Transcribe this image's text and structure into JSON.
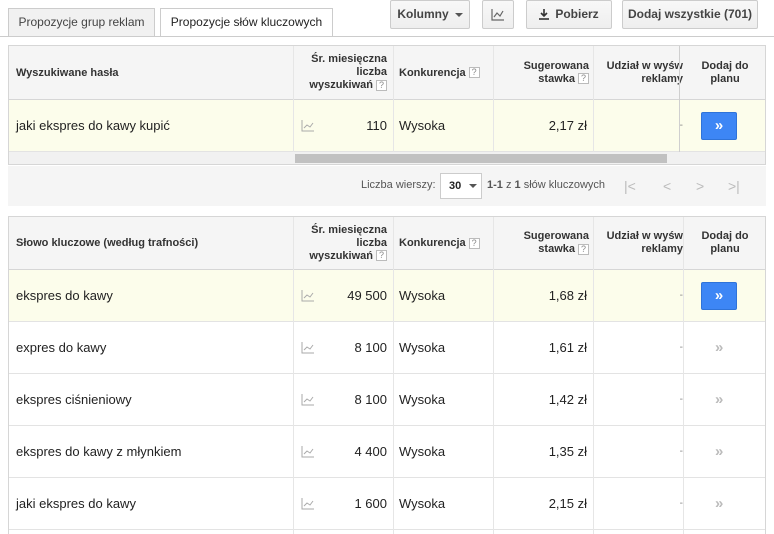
{
  "tabs": [
    {
      "label": "Propozycje grup reklam"
    },
    {
      "label": "Propozycje słów kluczowych"
    }
  ],
  "toolbar": {
    "columns_label": "Kolumny",
    "download_label": "Pobierz",
    "add_all_label": "Dodaj wszystkie (701)"
  },
  "searched": {
    "headers": {
      "term": "Wyszukiwane hasła",
      "avg1": "Śr. miesięczna",
      "avg2": "liczba",
      "avg3": "wyszukiwań",
      "competition": "Konkurencja",
      "bid1": "Sugerowana",
      "bid2": "stawka",
      "share1": "Udział w wyśw",
      "share2": "reklamy",
      "add1": "Dodaj do",
      "add2": "planu"
    },
    "rows": [
      {
        "term": "jaki ekspres do kawy kupić",
        "searches": "110",
        "competition": "Wysoka",
        "bid": "2,17 zł",
        "share": "-",
        "add": "»"
      }
    ]
  },
  "pager": {
    "rows_label": "Liczba wierszy:",
    "rows_value": "30",
    "range": "1-1",
    "of": "z",
    "total": "1",
    "suffix": "słów kluczowych"
  },
  "keywords": {
    "headers": {
      "term": "Słowo kluczowe (według trafności)",
      "avg1": "Śr. miesięczna",
      "avg2": "liczba",
      "avg3": "wyszukiwań",
      "competition": "Konkurencja",
      "bid1": "Sugerowana",
      "bid2": "stawka",
      "share1": "Udział w wyśw",
      "share2": "reklamy",
      "add1": "Dodaj do",
      "add2": "planu"
    },
    "rows": [
      {
        "term": "ekspres do kawy",
        "searches": "49 500",
        "competition": "Wysoka",
        "bid": "1,68 zł",
        "share": "-",
        "add": "»"
      },
      {
        "term": "expres do kawy",
        "searches": "8 100",
        "competition": "Wysoka",
        "bid": "1,61 zł",
        "share": "-",
        "add": "»"
      },
      {
        "term": "ekspres ciśnieniowy",
        "searches": "8 100",
        "competition": "Wysoka",
        "bid": "1,42 zł",
        "share": "-",
        "add": "»"
      },
      {
        "term": "ekspres do kawy z młynkiem",
        "searches": "4 400",
        "competition": "Wysoka",
        "bid": "1,35 zł",
        "share": "-",
        "add": "»"
      },
      {
        "term": "jaki ekspres do kawy",
        "searches": "1 600",
        "competition": "Wysoka",
        "bid": "2,15 zł",
        "share": "-",
        "add": "»"
      }
    ]
  },
  "colors": {
    "accent": "#3d86f5",
    "highlight": "#fcfdeb"
  }
}
